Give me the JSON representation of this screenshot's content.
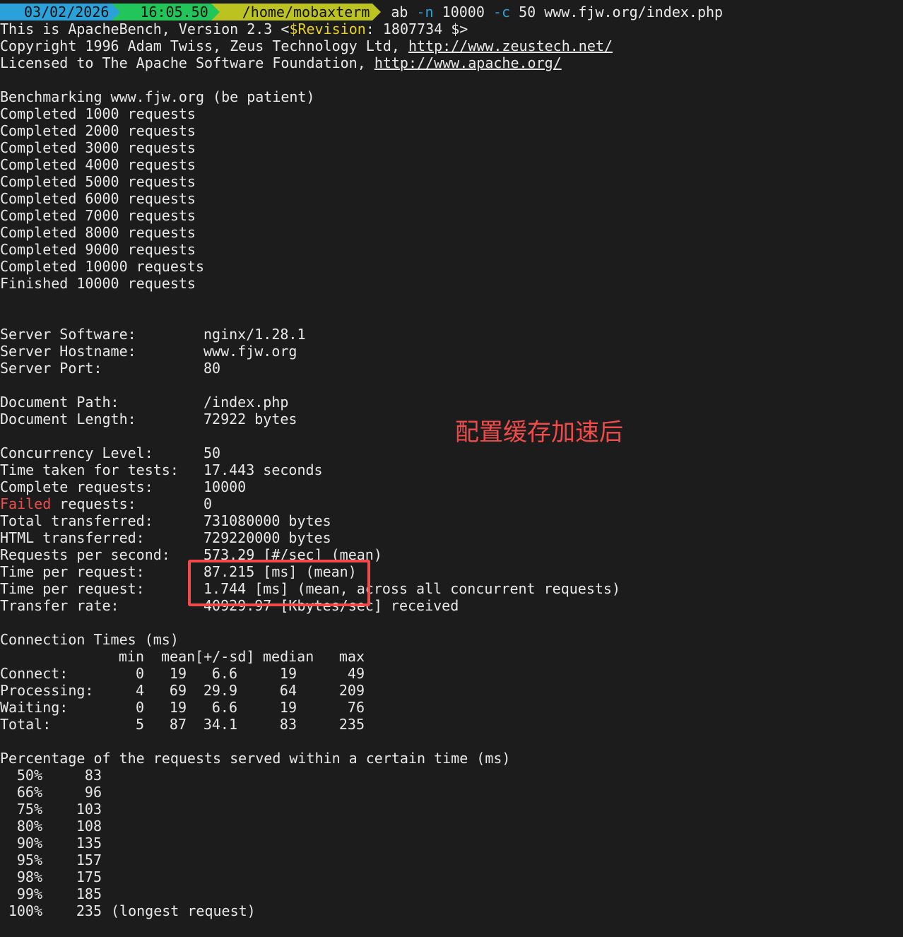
{
  "prompt": {
    "date": "03/02/2026",
    "time": "16:05.50",
    "path": "/home/mobaxterm",
    "command": {
      "prog": "ab",
      "flag_n": "-n",
      "n_value": "10000",
      "flag_c": "-c",
      "c_value": "50",
      "url": "www.fjw.org/index.php"
    },
    "colors": {
      "date_bg": "#2aa1d8",
      "time_bg": "#22c55a",
      "path_bg": "#bcc21f"
    },
    "icons": [
      "calendar-icon",
      "clock-icon",
      "folder-icon"
    ]
  },
  "header": {
    "line1_prefix": "This is ApacheBench, Version 2.3 <",
    "line1_revision_key": "$Revision",
    "line1_suffix": ": 1807734 $>",
    "line2_prefix": "Copyright 1996 Adam Twiss, Zeus Technology Ltd, ",
    "line2_link": "http://www.zeustech.net/",
    "line3_prefix": "Licensed to The Apache Software Foundation, ",
    "line3_link": "http://www.apache.org/"
  },
  "progress": {
    "benchmarking": "Benchmarking www.fjw.org (be patient)",
    "lines": [
      "Completed 1000 requests",
      "Completed 2000 requests",
      "Completed 3000 requests",
      "Completed 4000 requests",
      "Completed 5000 requests",
      "Completed 6000 requests",
      "Completed 7000 requests",
      "Completed 8000 requests",
      "Completed 9000 requests",
      "Completed 10000 requests",
      "Finished 10000 requests"
    ]
  },
  "server": [
    {
      "key": "Server Software:",
      "value": "nginx/1.28.1"
    },
    {
      "key": "Server Hostname:",
      "value": "www.fjw.org"
    },
    {
      "key": "Server Port:",
      "value": "80"
    }
  ],
  "document": [
    {
      "key": "Document Path:",
      "value": "/index.php"
    },
    {
      "key": "Document Length:",
      "value": "72922 bytes"
    }
  ],
  "stats": {
    "concurrency": {
      "key": "Concurrency Level:",
      "value": "50"
    },
    "time_taken": {
      "key": "Time taken for tests:",
      "value": "17.443 seconds"
    },
    "complete": {
      "key": "Complete requests:",
      "value": "10000"
    },
    "failed_word": "Failed",
    "failed_rest": " requests:",
    "failed_value": "0",
    "total_transferred": {
      "key": "Total transferred:",
      "value": "731080000 bytes"
    },
    "html_transferred": {
      "key": "HTML transferred:",
      "value": "729220000 bytes"
    },
    "rps": {
      "key": "Requests per second:",
      "value": "573.29 [#/sec] (mean)"
    },
    "tpr1": {
      "key": "Time per request:",
      "value": "87.215 [ms] (mean)"
    },
    "tpr2": {
      "key": "Time per request:",
      "value": "1.744 [ms] (mean, across all concurrent requests)"
    },
    "transfer_rate": {
      "key": "Transfer rate:",
      "value": "40929.97 [Kbytes/sec] received"
    }
  },
  "connection_times": {
    "title": "Connection Times (ms)",
    "headers": {
      "min": "min",
      "mean": "mean[+/-sd]",
      "median": "median",
      "max": "max"
    },
    "rows": [
      {
        "label": "Connect:",
        "min": "0",
        "mean": "19",
        "sd": "6.6",
        "median": "19",
        "max": "49"
      },
      {
        "label": "Processing:",
        "min": "4",
        "mean": "69",
        "sd": "29.9",
        "median": "64",
        "max": "209"
      },
      {
        "label": "Waiting:",
        "min": "0",
        "mean": "19",
        "sd": "6.6",
        "median": "19",
        "max": "76"
      },
      {
        "label": "Total:",
        "min": "5",
        "mean": "87",
        "sd": "34.1",
        "median": "83",
        "max": "235"
      }
    ]
  },
  "percentiles": {
    "title": "Percentage of the requests served within a certain time (ms)",
    "rows": [
      {
        "pct": "50%",
        "ms": "83",
        "note": ""
      },
      {
        "pct": "66%",
        "ms": "96",
        "note": ""
      },
      {
        "pct": "75%",
        "ms": "103",
        "note": ""
      },
      {
        "pct": "80%",
        "ms": "108",
        "note": ""
      },
      {
        "pct": "90%",
        "ms": "135",
        "note": ""
      },
      {
        "pct": "95%",
        "ms": "157",
        "note": ""
      },
      {
        "pct": "98%",
        "ms": "175",
        "note": ""
      },
      {
        "pct": "99%",
        "ms": "185",
        "note": ""
      },
      {
        "pct": "100%",
        "ms": "235",
        "note": "(longest request)"
      }
    ]
  },
  "annotation": {
    "text": "配置缓存加速后",
    "color": "#f04b4b"
  }
}
